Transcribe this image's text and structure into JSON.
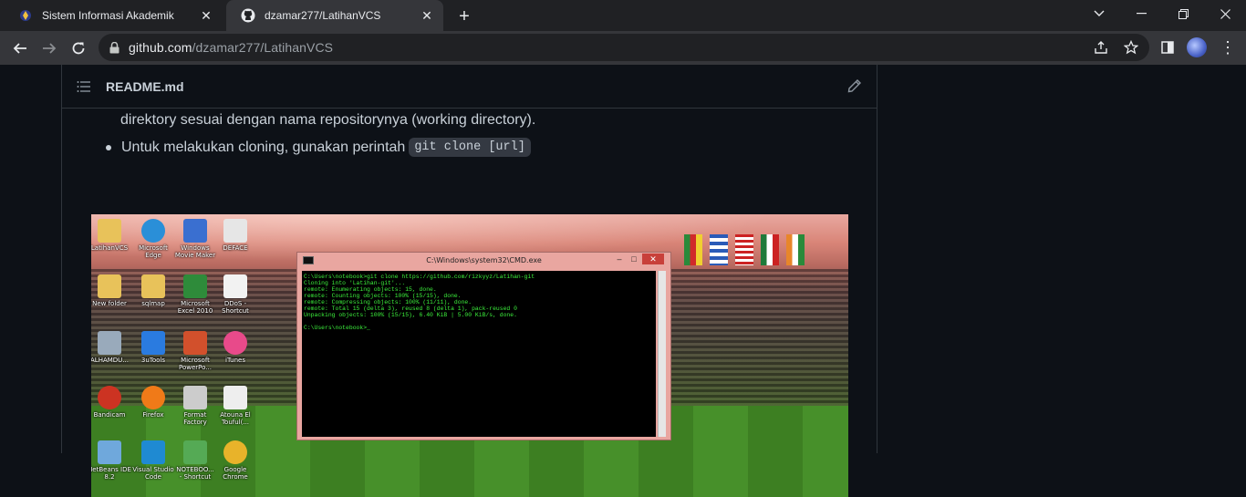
{
  "browser": {
    "tabs": [
      {
        "title": "Sistem Informasi Akademik",
        "active": false
      },
      {
        "title": "dzamar277/LatihanVCS",
        "active": true
      }
    ],
    "url_host": "github.com",
    "url_path": "/dzamar277/LatihanVCS"
  },
  "readme": {
    "filename": "README.md",
    "line_continued": "direktory sesuai dengan nama repositorynya (working directory).",
    "bullet_text": "Untuk melakukan cloning, gunakan perintah",
    "bullet_code": "git clone [url]"
  },
  "screenshot": {
    "desktop_icons": [
      {
        "label": "LatihanVCS",
        "icon": "folder-icon",
        "color": "#e8c25a"
      },
      {
        "label": "Microsoft\nEdge",
        "icon": "edge-icon",
        "color": "#2a8fd8"
      },
      {
        "label": "Windows\nMovie Maker",
        "icon": "movie-maker-icon",
        "color": "#3a6fd0"
      },
      {
        "label": "DEFACE",
        "icon": "document-icon",
        "color": "#e6e6e6"
      },
      {
        "label": "New folder",
        "icon": "folder-icon",
        "color": "#e8c25a"
      },
      {
        "label": "sqlmap",
        "icon": "folder-icon",
        "color": "#e8c25a"
      },
      {
        "label": "Microsoft\nExcel 2010",
        "icon": "excel-icon",
        "color": "#2e8b3a"
      },
      {
        "label": "DDoS -\nShortcut",
        "icon": "document-icon",
        "color": "#f2f2f2"
      },
      {
        "label": "ALHAMDU...",
        "icon": "gear-icon",
        "color": "#9ab"
      },
      {
        "label": "3uTools",
        "icon": "tools-icon",
        "color": "#2a7be0"
      },
      {
        "label": "Microsoft\nPowerPo...",
        "icon": "powerpoint-icon",
        "color": "#d2502c"
      },
      {
        "label": "iTunes",
        "icon": "itunes-icon",
        "color": "#e84a8a"
      },
      {
        "label": "Bandicam",
        "icon": "bandicam-icon",
        "color": "#c32"
      },
      {
        "label": "Firefox",
        "icon": "firefox-icon",
        "color": "#f07a18"
      },
      {
        "label": "Format\nFactory",
        "icon": "format-factory-icon",
        "color": "#ccc"
      },
      {
        "label": "Atouna El\nTouful(...",
        "icon": "audio-file-icon",
        "color": "#eee"
      },
      {
        "label": "NetBeans IDE\n8.2",
        "icon": "netbeans-icon",
        "color": "#6fa8dc"
      },
      {
        "label": "Visual Studio\nCode",
        "icon": "vscode-icon",
        "color": "#1f8ad2"
      },
      {
        "label": "NOTEBOO...\n- Shortcut",
        "icon": "notebook-icon",
        "color": "#5a5"
      },
      {
        "label": "Google\nChrome",
        "icon": "chrome-icon",
        "color": "#e8b32a"
      }
    ],
    "cmd": {
      "title": "C:\\Windows\\system32\\CMD.exe",
      "lines": [
        "C:\\Users\\notebook>git clone https://github.com/rizkyyz/Latihan-git",
        "Cloning into 'Latihan-git'...",
        "remote: Enumerating objects: 15, done.",
        "remote: Counting objects: 100% (15/15), done.",
        "remote: Compressing objects: 100% (11/11), done.",
        "remote: Total 15 (delta 3), reused 8 (delta 1), pack-reused 0",
        "Unpacking objects: 100% (15/15), 6.40 KiB | 5.00 KiB/s, done.",
        "",
        "C:\\Users\\notebook>_"
      ]
    }
  }
}
